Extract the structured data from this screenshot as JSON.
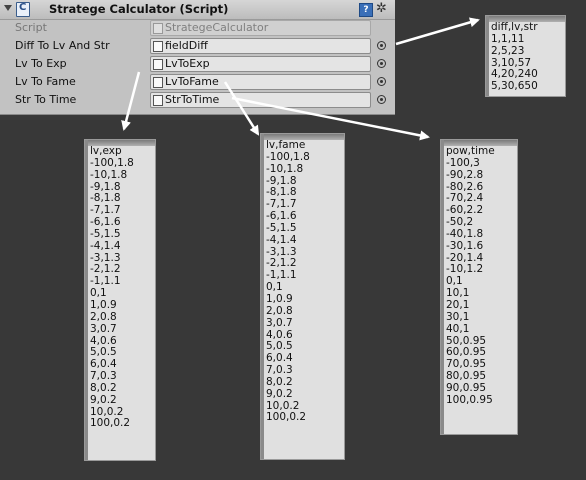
{
  "inspector": {
    "title": "Stratege Calculator (Script)",
    "help_label": "?",
    "gear_symbol": "✲",
    "rows": [
      {
        "label": "Script",
        "value": "StrategeCalculator",
        "disabled": true
      },
      {
        "label": "Diff To Lv And Str",
        "value": "fieldDiff",
        "disabled": false
      },
      {
        "label": "Lv To Exp",
        "value": "LvToExp",
        "disabled": false
      },
      {
        "label": "Lv To Fame",
        "value": "LvToFame",
        "disabled": false
      },
      {
        "label": "Str To Time",
        "value": "StrToTime",
        "disabled": false
      }
    ]
  },
  "panels": {
    "fieldDiff": "diff,lv,str\n1,1,11\n2,5,23\n3,10,57\n4,20,240\n5,30,650",
    "lvToExp": "lv,exp\n-100,1.8\n-10,1.8\n-9,1.8\n-8,1.8\n-7,1.7\n-6,1.6\n-5,1.5\n-4,1.4\n-3,1.3\n-2,1.2\n-1,1.1\n0,1\n1,0.9\n2,0.8\n3,0.7\n4,0.6\n5,0.5\n6,0.4\n7,0.3\n8,0.2\n9,0.2\n10,0.2\n100,0.2",
    "lvToFame": "lv,fame\n-100,1.8\n-10,1.8\n-9,1.8\n-8,1.8\n-7,1.7\n-6,1.6\n-5,1.5\n-4,1.4\n-3,1.3\n-2,1.2\n-1,1.1\n0,1\n1,0.9\n2,0.8\n3,0.7\n4,0.6\n5,0.5\n6,0.4\n7,0.3\n8,0.2\n9,0.2\n10,0.2\n100,0.2",
    "strToTime": "pow,time\n-100,3\n-90,2.8\n-80,2.6\n-70,2.4\n-60,2.2\n-50,2\n-40,1.8\n-30,1.6\n-20,1.4\n-10,1.2\n0,1\n10,1\n20,1\n30,1\n40,1\n50,0.95\n60,0.95\n70,0.95\n80,0.95\n90,0.95\n100,0.95"
  },
  "colors": {
    "background": "#383838",
    "inspector": "#c2c2c2",
    "panel": "#e0e0e0",
    "arrow": "#ffffff"
  }
}
